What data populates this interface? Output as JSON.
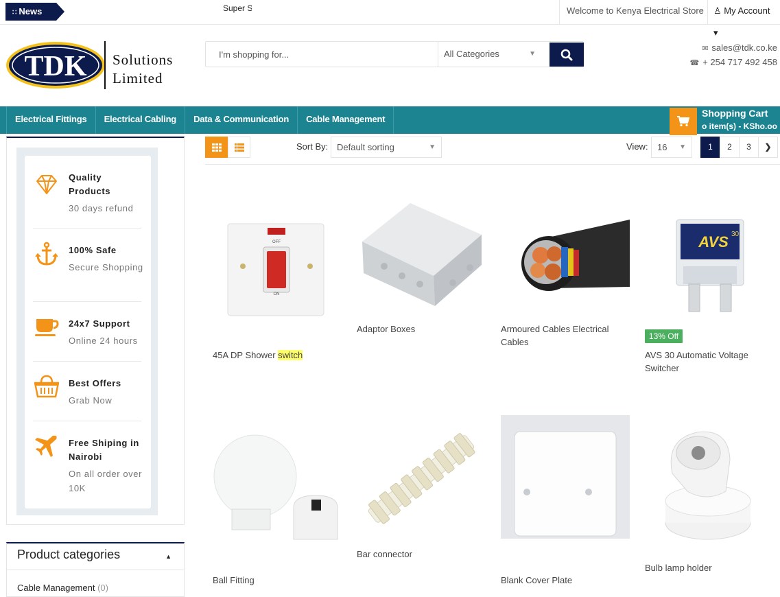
{
  "topbar": {
    "news_label": "News",
    "ticker_text": "Super S",
    "welcome": "Welcome to Kenya Electrical Store",
    "account": "My Account"
  },
  "header": {
    "logo_mark": "TDK",
    "logo_line1": "Solutions",
    "logo_line2": "Limited",
    "search_placeholder": "I'm shopping for...",
    "category_select": "All Categories",
    "email": "sales@tdk.co.ke",
    "phone": "+ 254 717 492 458"
  },
  "nav": {
    "items": [
      "Electrical Fittings",
      "Electrical Cabling",
      "Data & Communication",
      "Cable Management"
    ]
  },
  "cart": {
    "title": "Shopping Cart",
    "summary": "o item(s) - KSho.oo"
  },
  "features": [
    {
      "icon": "diamond-icon",
      "title": "Quality Products",
      "sub": "30 days refund"
    },
    {
      "icon": "anchor-icon",
      "title": "100% Safe",
      "sub": "Secure Shopping"
    },
    {
      "icon": "cup-icon",
      "title": "24x7 Support",
      "sub": "Online 24 hours"
    },
    {
      "icon": "basket-icon",
      "title": "Best Offers",
      "sub": "Grab Now"
    },
    {
      "icon": "plane-icon",
      "title": "Free Shiping in Nairobi",
      "sub": "On all order over 10K"
    }
  ],
  "categories": {
    "title": "Product categories",
    "items": [
      {
        "name": "Cable Management",
        "count": "(0)"
      }
    ]
  },
  "toolbar": {
    "sort_label": "Sort By:",
    "sort_value": "Default sorting",
    "view_label": "View:",
    "view_value": "16",
    "pages": [
      "1",
      "2",
      "3"
    ]
  },
  "products": [
    {
      "name": "45A DP Shower",
      "highlight": "switch",
      "img": "shower-switch"
    },
    {
      "name": "Adaptor Boxes",
      "img": "adaptor-box"
    },
    {
      "name": "Armoured Cables Electrical Cables",
      "img": "armoured-cable"
    },
    {
      "name": "AVS 30 Automatic Voltage Switcher",
      "badge": "13% Off",
      "img": "avs30"
    },
    {
      "name": "Ball Fitting",
      "img": "ball-fitting"
    },
    {
      "name": "Bar connector",
      "img": "bar-connector"
    },
    {
      "name": "Blank Cover Plate",
      "img": "blank-plate"
    },
    {
      "name": "Bulb lamp holder",
      "img": "lamp-holder"
    }
  ],
  "avs_label": "AVS",
  "avs_label_num": "30",
  "colors": {
    "navy": "#0d1b4c",
    "teal": "#1c8391",
    "orange": "#f39318",
    "sale": "#4caf60"
  }
}
